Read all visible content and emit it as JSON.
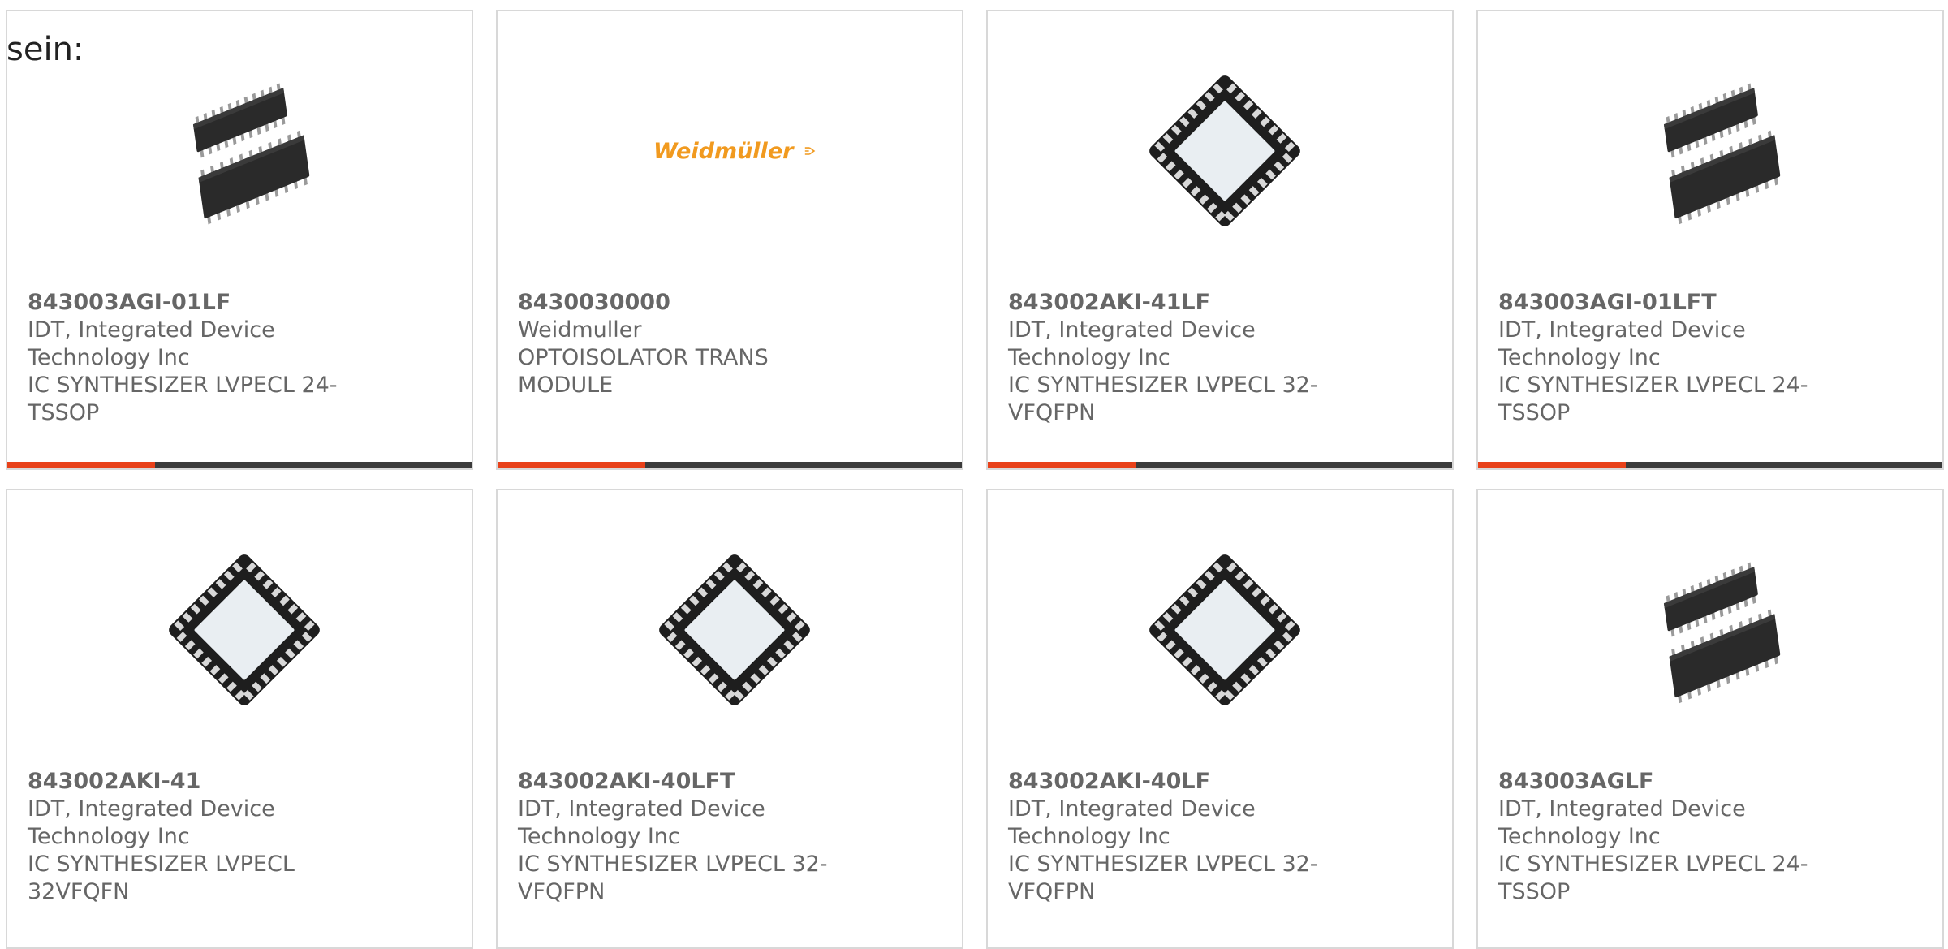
{
  "heading": "sein:",
  "accent_color": "#e8411a",
  "bar_color": "#3b3b3b",
  "logo_color": "#f19a1f",
  "products": [
    {
      "part": "843003AGI-01LF",
      "mfr": "IDT, Integrated Device Technology Inc",
      "desc": "IC SYNTHESIZER LVPECL 24-TSSOP",
      "image": "tssop-chip-icon"
    },
    {
      "part": "8430030000",
      "mfr": "Weidmuller",
      "desc": "OPTOISOLATOR TRANS MODULE",
      "image": "weidmuller-logo",
      "logo_text": "Weidmüller"
    },
    {
      "part": "843002AKI-41LF",
      "mfr": "IDT, Integrated Device Technology Inc",
      "desc": "IC SYNTHESIZER LVPECL 32-VFQFPN",
      "image": "qfn-chip-icon"
    },
    {
      "part": "843003AGI-01LFT",
      "mfr": "IDT, Integrated Device Technology Inc",
      "desc": "IC SYNTHESIZER LVPECL 24-TSSOP",
      "image": "tssop-chip-icon"
    },
    {
      "part": "843002AKI-41",
      "mfr": "IDT, Integrated Device Technology Inc",
      "desc": "IC SYNTHESIZER LVPECL 32VFQFN",
      "image": "qfn-chip-icon"
    },
    {
      "part": "843002AKI-40LFT",
      "mfr": "IDT, Integrated Device Technology Inc",
      "desc": "IC SYNTHESIZER LVPECL 32-VFQFPN",
      "image": "qfn-chip-icon"
    },
    {
      "part": "843002AKI-40LF",
      "mfr": "IDT, Integrated Device Technology Inc",
      "desc": "IC SYNTHESIZER LVPECL 32-VFQFPN",
      "image": "qfn-chip-icon"
    },
    {
      "part": "843003AGLF",
      "mfr": "IDT, Integrated Device Technology Inc",
      "desc": "IC SYNTHESIZER LVPECL 24-TSSOP",
      "image": "tssop-chip-icon"
    }
  ]
}
